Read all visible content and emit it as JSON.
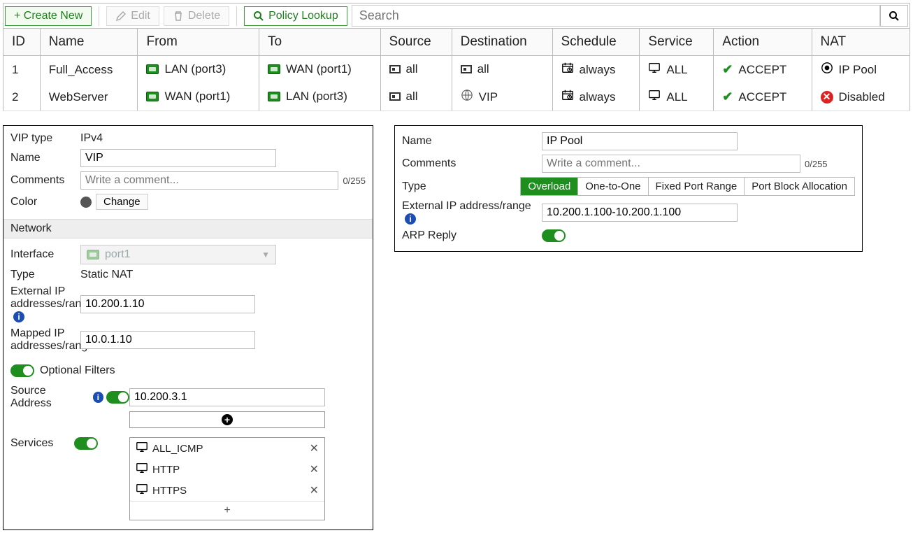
{
  "toolbar": {
    "create": "+ Create New",
    "edit": "Edit",
    "delete": "Delete",
    "lookup": "Policy Lookup",
    "search_placeholder": "Search"
  },
  "headers": [
    "ID",
    "Name",
    "From",
    "To",
    "Source",
    "Destination",
    "Schedule",
    "Service",
    "Action",
    "NAT"
  ],
  "rows": [
    {
      "id": "1",
      "name": "Full_Access",
      "from": "LAN (port3)",
      "to": "WAN (port1)",
      "source": "all",
      "dest": "all",
      "dest_icon": "addr",
      "schedule": "always",
      "service": "ALL",
      "action": "ACCEPT",
      "nat": "IP Pool",
      "nat_icon": "pool"
    },
    {
      "id": "2",
      "name": "WebServer",
      "from": "WAN (port1)",
      "to": "LAN (port3)",
      "source": "all",
      "dest": "VIP",
      "dest_icon": "globe",
      "schedule": "always",
      "service": "ALL",
      "action": "ACCEPT",
      "nat": "Disabled",
      "nat_icon": "disabled"
    }
  ],
  "vip": {
    "vip_type_label": "VIP type",
    "vip_type": "IPv4",
    "name_label": "Name",
    "name": "VIP",
    "comments_label": "Comments",
    "comments_ph": "Write a comment...",
    "comments_count": "0/255",
    "color_label": "Color",
    "change": "Change",
    "network_section": "Network",
    "interface_label": "Interface",
    "interface": "port1",
    "type_label": "Type",
    "type": "Static NAT",
    "ext_label": "External IP addresses/range",
    "ext": "10.200.1.10",
    "mapped_label": "Mapped IP addresses/range",
    "mapped": "10.0.1.10",
    "opt_filters": "Optional Filters",
    "srcaddr_label": "Source Address",
    "srcaddr": "10.200.3.1",
    "services_label": "Services",
    "services": [
      "ALL_ICMP",
      "HTTP",
      "HTTPS"
    ]
  },
  "ippool": {
    "name_label": "Name",
    "name": "IP Pool",
    "comments_label": "Comments",
    "comments_ph": "Write a comment...",
    "comments_count": "0/255",
    "type_label": "Type",
    "types": [
      "Overload",
      "One-to-One",
      "Fixed Port Range",
      "Port Block Allocation"
    ],
    "type_selected": "Overload",
    "ext_label": "External IP address/range",
    "ext": "10.200.1.100-10.200.1.100",
    "arp_label": "ARP Reply"
  }
}
